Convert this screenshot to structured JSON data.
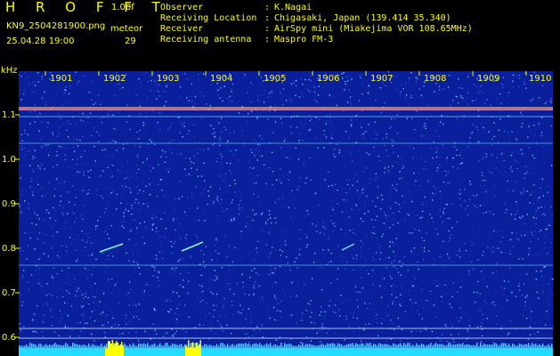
{
  "header": {
    "title": "H R O F F T",
    "version": "1.00f",
    "filename": "KN9_2504281900.png",
    "mode": "meteor",
    "timestamp": "25.04.28 19:00",
    "count": "29"
  },
  "info": [
    {
      "label": "Observer",
      "value": "K.Nagai"
    },
    {
      "label": "Receiving Location",
      "value": "Chigasaki, Japan (139.414 35.340)"
    },
    {
      "label": "Receiver",
      "value": "AirSpy mini (Miakejima VOR 108.65MHz)"
    },
    {
      "label": "Receiving antenna",
      "value": "Maspro FM-3"
    }
  ],
  "info_separator": ":",
  "axis": {
    "y_unit": "kHz",
    "y_ticks": [
      "1.1",
      "1.0",
      "0.9",
      "0.8",
      "0.7",
      "0.6"
    ],
    "x_ticks": [
      "1901",
      "1902",
      "1903",
      "1904",
      "1905",
      "1906",
      "1907",
      "1908",
      "1909",
      "1910"
    ]
  },
  "colors": {
    "background": "#000000",
    "label_yellow": "#ffff00",
    "info_white": "#ffffff",
    "spectrogram_blue": "#0a1f9c",
    "carrier_line": "#ff5050",
    "baseline_cyan": "#22ddff",
    "burst_yellow": "#ffff00"
  }
}
